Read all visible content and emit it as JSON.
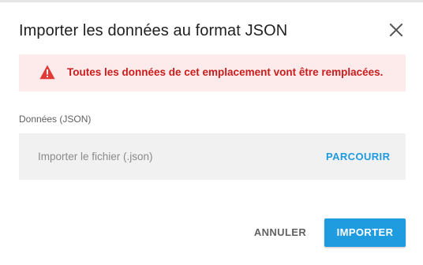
{
  "dialog": {
    "title": "Importer les données au format JSON",
    "close_icon": "close-icon"
  },
  "alert": {
    "icon": "warning-triangle-icon",
    "message": "Toutes les données de cet emplacement vont être remplacées.",
    "color": "#c91d1d",
    "background": "#fdeaea"
  },
  "field": {
    "label": "Données (JSON)",
    "placeholder": "Importer le fichier (.json)",
    "browse_label": "PARCOURIR"
  },
  "actions": {
    "cancel_label": "ANNULER",
    "import_label": "IMPORTER",
    "accent": "#1f9be0"
  }
}
